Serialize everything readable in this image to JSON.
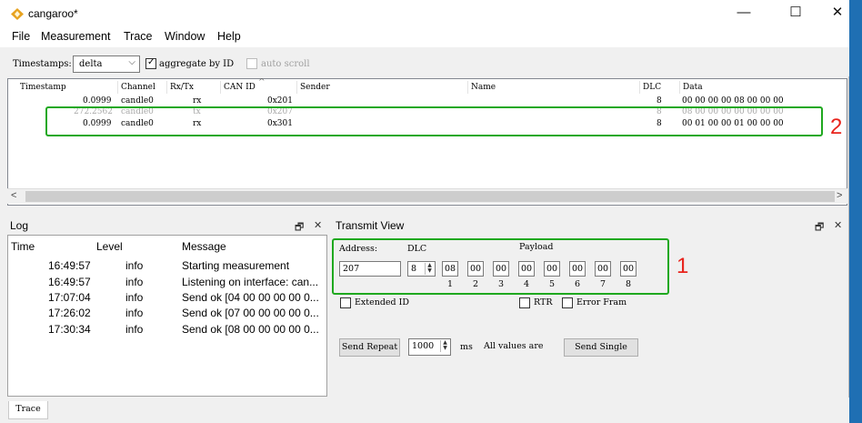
{
  "window": {
    "title": "cangaroo*",
    "minimize": "—",
    "maximize": "☐",
    "close": "✕"
  },
  "menu": [
    "File",
    "Measurement",
    "Trace",
    "Window",
    "Help"
  ],
  "toolbar": {
    "timestamps_label": "Timestamps:",
    "timestamps_value": "delta",
    "aggregate_label": "aggregate by ID",
    "aggregate_checked": true,
    "autoscroll_label": "auto scroll",
    "autoscroll_checked": false
  },
  "trace": {
    "columns": [
      "Timestamp",
      "Channel",
      "Rx/Tx",
      "CAN ID",
      "Sender",
      "Name",
      "DLC",
      "Data"
    ],
    "sort_indicator": "^",
    "rows": [
      {
        "timestamp": "0.0999",
        "channel": "candle0",
        "rxtx": "rx",
        "can_id": "0x201",
        "dlc": "8",
        "data": "00 00 00 00 08 00 00 00",
        "faded": false
      },
      {
        "timestamp": "272.2562",
        "channel": "candle0",
        "rxtx": "tx",
        "can_id": "0x207",
        "dlc": "8",
        "data": "08 00 00 00 00 00 00 00",
        "faded": true
      },
      {
        "timestamp": "0.0999",
        "channel": "candle0",
        "rxtx": "rx",
        "can_id": "0x301",
        "dlc": "8",
        "data": "00 01 00 00 01 00 00 00",
        "faded": false
      }
    ]
  },
  "annotations": {
    "label_1": "1",
    "label_2": "2"
  },
  "log": {
    "title": "Log",
    "float_icon": "🗗",
    "close_icon": "✕",
    "columns": [
      "Time",
      "Level",
      "Message"
    ],
    "rows": [
      {
        "time": "16:49:57",
        "level": "info",
        "message": "Starting measurement"
      },
      {
        "time": "16:49:57",
        "level": "info",
        "message": "Listening on interface: can..."
      },
      {
        "time": "17:07:04",
        "level": "info",
        "message": "Send ok [04 00 00 00 00 0..."
      },
      {
        "time": "17:26:02",
        "level": "info",
        "message": "Send ok [07 00 00 00 00 0..."
      },
      {
        "time": "17:30:34",
        "level": "info",
        "message": "Send ok [08 00 00 00 00 0..."
      }
    ]
  },
  "transmit": {
    "title": "Transmit View",
    "float_icon": "🗗",
    "close_icon": "✕",
    "address_label": "Address:",
    "address_value": "207",
    "dlc_label": "DLC",
    "dlc_value": "8",
    "payload_label": "Payload",
    "payload": [
      "08",
      "00",
      "00",
      "00",
      "00",
      "00",
      "00",
      "00"
    ],
    "payload_indices": [
      "1",
      "2",
      "3",
      "4",
      "5",
      "6",
      "7",
      "8"
    ],
    "extended_id_label": "Extended ID",
    "rtr_label": "RTR",
    "error_frame_label": "Error Fram",
    "send_repeat_label": "Send Repeat",
    "repeat_value": "1000",
    "ms_label": "ms",
    "all_values_label": "All values are",
    "send_single_label": "Send Single"
  },
  "status": {
    "tab": "Trace"
  },
  "colors": {
    "annotation_green": "#1fa81f",
    "annotation_red": "#e8231c",
    "desktop": "#1f6fb3"
  }
}
